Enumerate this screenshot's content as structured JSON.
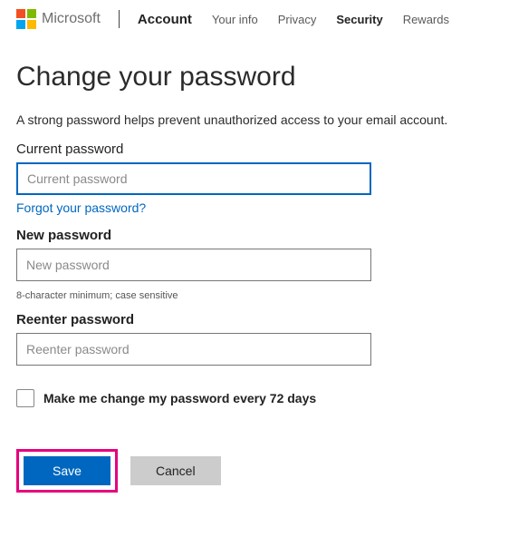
{
  "header": {
    "brand": "Microsoft",
    "nav": {
      "account": "Account",
      "your_info": "Your info",
      "privacy": "Privacy",
      "security": "Security",
      "rewards": "Rewards"
    }
  },
  "page": {
    "title": "Change your password",
    "subtitle": "A strong password helps prevent unauthorized access to your email account.",
    "current_label": "Current password",
    "current_placeholder": "Current password",
    "forgot_link": "Forgot your password?",
    "new_label": "New password",
    "new_placeholder": "New password",
    "hint": "8-character minimum; case sensitive",
    "reenter_label": "Reenter password",
    "reenter_placeholder": "Reenter password",
    "checkbox_label": "Make me change my password every 72 days",
    "save_label": "Save",
    "cancel_label": "Cancel"
  }
}
